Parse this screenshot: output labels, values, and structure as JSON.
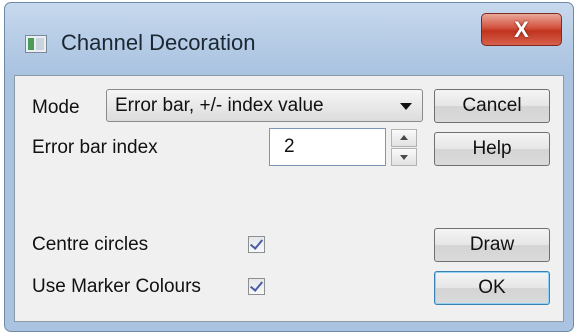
{
  "window": {
    "title": "Channel Decoration",
    "close_glyph": "X"
  },
  "form": {
    "mode_label": "Mode",
    "mode_value": "Error bar, +/- index value",
    "error_bar_index_label": "Error bar index",
    "error_bar_index_value": "2",
    "centre_circles_label": "Centre circles",
    "centre_circles_checked": true,
    "use_marker_colours_label": "Use Marker Colours",
    "use_marker_colours_checked": true
  },
  "buttons": {
    "cancel": "Cancel",
    "help": "Help",
    "draw": "Draw",
    "ok": "OK"
  },
  "icons": {
    "app": "channel-decoration-app-icon",
    "close": "close-icon",
    "dropdown": "chevron-down-icon",
    "spin_up": "spin-up-icon",
    "spin_down": "spin-down-icon",
    "check": "check-icon"
  },
  "colors": {
    "titlebar": "#b8cde6",
    "close_button": "#c9432e",
    "client_bg": "#f0f0f0"
  }
}
